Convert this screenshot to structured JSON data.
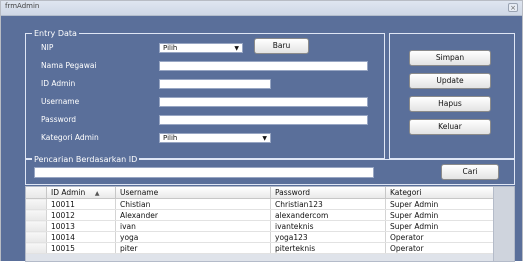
{
  "window": {
    "title": "frmAdmin",
    "close_icon": "×"
  },
  "entry_group": {
    "legend": "Entry Data",
    "labels": [
      "NIP",
      "Nama Pegawai",
      "ID Admin",
      "Username",
      "Password",
      "Kategori Admin"
    ],
    "nip_combo_value": "Pilih",
    "kategori_combo_value": "Pilih",
    "baru_button": "Baru",
    "nama_pegawai_value": "",
    "id_admin_value": "",
    "username_value": "",
    "password_value": ""
  },
  "actions": {
    "simpan": "Simpan",
    "update": "Update",
    "hapus": "Hapus",
    "keluar": "Keluar"
  },
  "search_group": {
    "legend": "Pencarian Berdasarkan ID",
    "query": "",
    "cari_button": "Cari"
  },
  "grid": {
    "columns": [
      "ID Admin",
      "Username",
      "Password",
      "Kategori"
    ],
    "sort_indicator": "▲",
    "rows": [
      [
        "10011",
        "Chistian",
        "Christian123",
        "Super Admin"
      ],
      [
        "10012",
        "Alexander",
        "alexandercom",
        "Super Admin"
      ],
      [
        "10013",
        "ivan",
        "ivanteknis",
        "Super Admin"
      ],
      [
        "10014",
        "yoga",
        "yoga123",
        "Operator"
      ],
      [
        "10015",
        "piter",
        "piterteknis",
        "Operator"
      ]
    ]
  }
}
